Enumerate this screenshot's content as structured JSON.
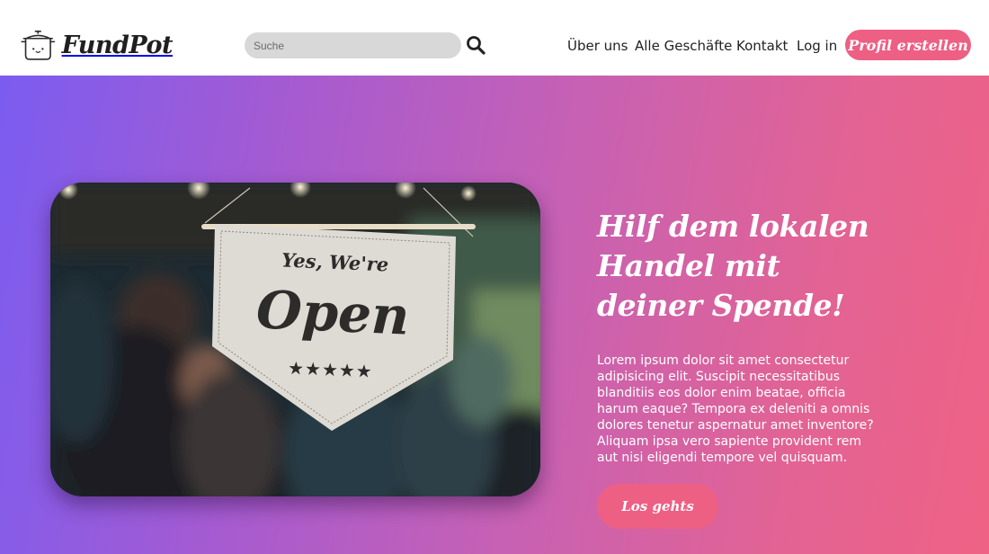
{
  "brand": {
    "name": "FundPot",
    "icon": "cooking-pot-icon"
  },
  "search": {
    "placeholder": "Suche",
    "value": "",
    "icon": "search-icon"
  },
  "nav": {
    "about": "Über uns",
    "shops": "Alle Geschäfte",
    "contact": "Kontakt",
    "login": "Log in",
    "signup": "Profil erstellen"
  },
  "hero": {
    "headline": "Hilf dem lokalen Handel mit deiner Spende!",
    "body": "Lorem ipsum dolor sit amet consectetur adipisicing elit. Suscipit necessitatibus blanditiis eos dolor enim beatae, officia harum eaque? Tempora ex deleniti a omnis dolores tenetur aspernatur amet inventore? Aliquam ipsa vero sapiente provident rem aut nisi eligendi tempore vel quisquam.",
    "cta": "Los gehts",
    "image": {
      "sign_line1": "Yes, We're",
      "sign_line2": "Open",
      "sign_stars": "★★★★★"
    }
  },
  "colors": {
    "accent": "#ee5f84",
    "gradient_start": "#7b5cf0",
    "gradient_end": "#ef6285"
  }
}
